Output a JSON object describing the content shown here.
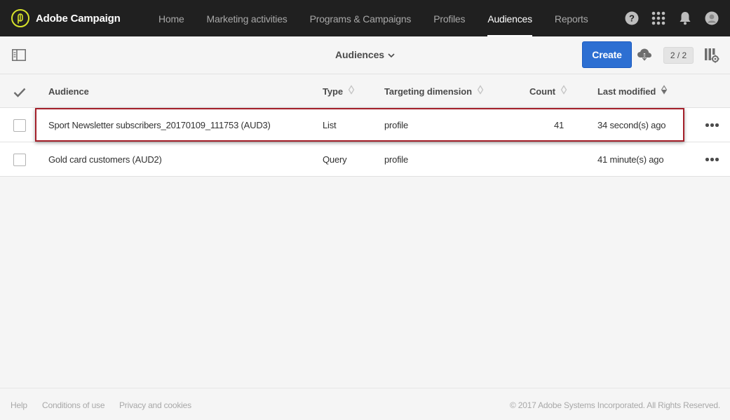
{
  "app": {
    "name": "Adobe Campaign"
  },
  "nav": {
    "items": [
      {
        "label": "Home",
        "active": false
      },
      {
        "label": "Marketing activities",
        "active": false
      },
      {
        "label": "Programs & Campaigns",
        "active": false
      },
      {
        "label": "Profiles",
        "active": false
      },
      {
        "label": "Audiences",
        "active": true
      },
      {
        "label": "Reports",
        "active": false
      }
    ],
    "icons": [
      "help-icon",
      "apps-grid-icon",
      "notification-bell-icon",
      "user-avatar-icon"
    ]
  },
  "toolbar": {
    "view_title": "Audiences",
    "create_label": "Create",
    "pager": "2 / 2"
  },
  "table": {
    "columns": {
      "audience": "Audience",
      "type": "Type",
      "targeting": "Targeting dimension",
      "count": "Count",
      "last_modified": "Last modified"
    },
    "rows": [
      {
        "name": "Sport Newsletter subscribers_20170109_111753 (AUD3)",
        "type": "List",
        "targeting": "profile",
        "count": "41",
        "modified": "34 second(s) ago",
        "highlighted": true
      },
      {
        "name": "Gold card customers (AUD2)",
        "type": "Query",
        "targeting": "profile",
        "count": "",
        "modified": "41 minute(s) ago",
        "highlighted": false
      }
    ]
  },
  "footer": {
    "help": "Help",
    "conditions": "Conditions of use",
    "privacy": "Privacy and cookies",
    "copyright": "© 2017 Adobe Systems Incorporated. All Rights Reserved."
  },
  "colors": {
    "topbar": "#202020",
    "accent_logo": "#d7e22a",
    "primary_button": "#2d6fd2",
    "highlight_border": "#a4202a"
  }
}
